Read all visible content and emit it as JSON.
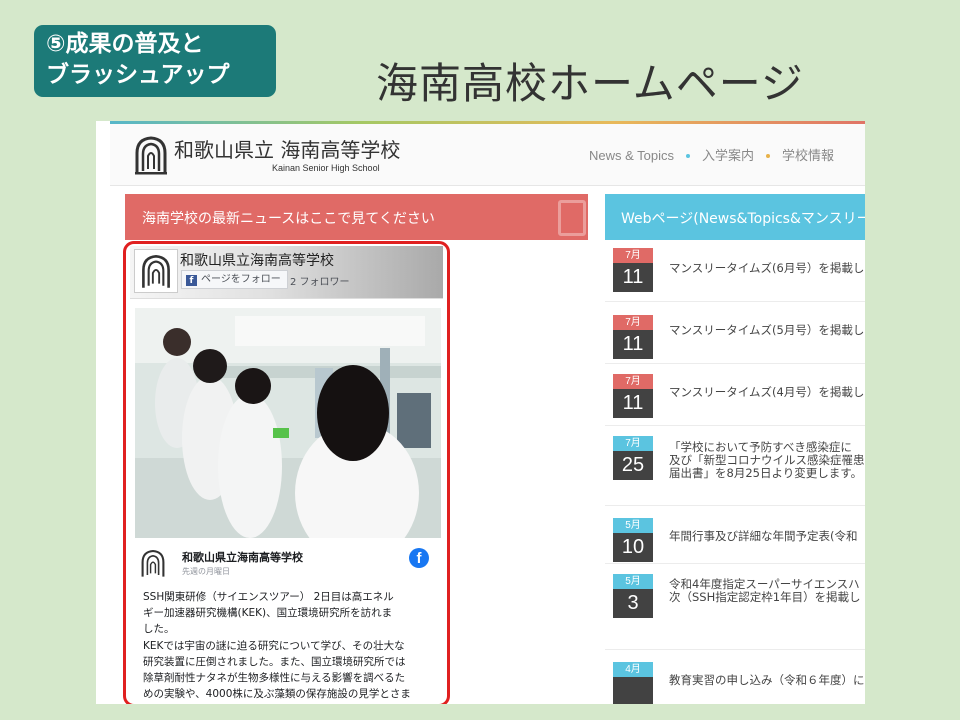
{
  "slide": {
    "badge_line1": "⑤成果の普及と",
    "badge_line2": "ブラッシュアップ",
    "title": "海南高校ホームページ"
  },
  "site": {
    "name": "和歌山県立 海南高等学校",
    "subname": "Kainan Senior High School",
    "nav": [
      "News & Topics",
      "入学案内",
      "学校情報"
    ],
    "nav_dot_colors": [
      "#5bc4e0",
      "#e8b24a"
    ]
  },
  "facebook_section": {
    "heading": "海南学校の最新ニュースはここで見てください",
    "page_name": "和歌山県立海南高等学校",
    "follow_label": "ページをフォロー",
    "followers": "2 フォロワー",
    "post": {
      "author": "和歌山県立海南高等学校",
      "time": "先週の月曜日",
      "text": "SSH関東研修（サイエンスツアー） 2日目は高エネル\nギー加速器研究機構(KEK)、国立環境研究所を訪れま\nした。\nKEKでは宇宙の謎に迫る研究について学び、その壮大な\n研究装置に圧倒されました。また、国立環境研究所では\n除草剤耐性ナタネが生物多様性に与える影響を調べるた\nめの実験や、4000株に及ぶ藻類の保存施設の見学とさま\nざまな藻類の観察を行いました。"
    }
  },
  "web_section": {
    "heading": "Webページ(News&Topics&マンスリー情",
    "items": [
      {
        "month": "7月",
        "day": "11",
        "text": "マンスリータイムズ(6月号）を掲載し",
        "color": "#e06a66"
      },
      {
        "month": "7月",
        "day": "11",
        "text": "マンスリータイムズ(5月号）を掲載し",
        "color": "#e06a66"
      },
      {
        "month": "7月",
        "day": "11",
        "text": "マンスリータイムズ(4月号）を掲載し",
        "color": "#e06a66"
      },
      {
        "month": "7月",
        "day": "25",
        "text": "「学校において予防すべき感染症に\n及び「新型コロナウイルス感染症罹患\n届出書」を8月25日より変更します。",
        "color": "#5bc4e0"
      },
      {
        "month": "5月",
        "day": "10",
        "text": "年間行事及び詳細な年間予定表(令和",
        "color": "#5bc4e0"
      },
      {
        "month": "5月",
        "day": "3",
        "text": "令和4年度指定スーパーサイエンスハ\n次（SSH指定認定枠1年目）を掲載し",
        "color": "#5bc4e0"
      },
      {
        "month": "4月",
        "day": "",
        "text": "教育実習の申し込み（令和６年度）に",
        "color": "#5bc4e0"
      }
    ]
  }
}
